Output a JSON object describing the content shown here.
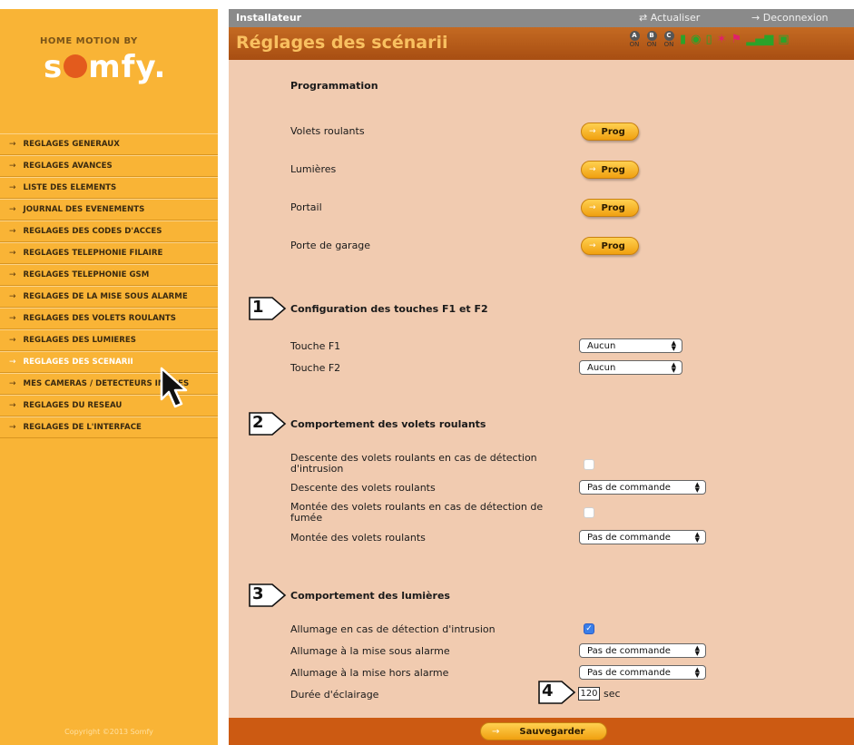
{
  "sidebar": {
    "brand_top": "HOME MOTION BY",
    "brand_logo_start": "s",
    "brand_logo_end": "mfy.",
    "menu": [
      {
        "label": "REGLAGES GENERAUX",
        "active": false
      },
      {
        "label": "REGLAGES AVANCES",
        "active": false
      },
      {
        "label": "LISTE DES ELEMENTS",
        "active": false
      },
      {
        "label": "JOURNAL DES EVENEMENTS",
        "active": false
      },
      {
        "label": "REGLAGES DES CODES D'ACCES",
        "active": false
      },
      {
        "label": "REGLAGES TELEPHONIE FILAIRE",
        "active": false
      },
      {
        "label": "REGLAGES TELEPHONIE GSM",
        "active": false
      },
      {
        "label": "REGLAGES DE LA MISE SOUS ALARME",
        "active": false
      },
      {
        "label": "REGLAGES DES VOLETS ROULANTS",
        "active": false
      },
      {
        "label": "REGLAGES DES LUMIERES",
        "active": false
      },
      {
        "label": "REGLAGES DES SCENARII",
        "active": true
      },
      {
        "label": "MES CAMERAS / DETECTEURS IMAGES",
        "active": false
      },
      {
        "label": "REGLAGES DU RESEAU",
        "active": false
      },
      {
        "label": "REGLAGES DE L'INTERFACE",
        "active": false
      }
    ],
    "copyright": "Copyright ©2013 Somfy"
  },
  "header": {
    "role": "Installateur",
    "refresh": "Actualiser",
    "logout": "Deconnexion",
    "page_title": "Réglages des scénarii",
    "zones": [
      {
        "letter": "A",
        "state": "ON"
      },
      {
        "letter": "B",
        "state": "ON"
      },
      {
        "letter": "C",
        "state": "ON"
      }
    ]
  },
  "programmation": {
    "title": "Programmation",
    "items": [
      {
        "label": "Volets roulants",
        "button": "Prog"
      },
      {
        "label": "Lumières",
        "button": "Prog"
      },
      {
        "label": "Portail",
        "button": "Prog"
      },
      {
        "label": "Porte de garage",
        "button": "Prog"
      }
    ]
  },
  "config_touches": {
    "marker": "1",
    "title": "Configuration des touches F1 et F2",
    "f1_label": "Touche F1",
    "f1_value": "Aucun",
    "f2_label": "Touche F2",
    "f2_value": "Aucun"
  },
  "volets": {
    "marker": "2",
    "title": "Comportement des volets roulants",
    "descente_intrusion_label": "Descente des volets roulants en cas de détection d'intrusion",
    "descente_intrusion_checked": false,
    "descente_label": "Descente des volets roulants",
    "descente_value": "Pas de commande",
    "montee_fumee_label": "Montée des volets roulants en cas de détection de fumée",
    "montee_fumee_checked": false,
    "montee_label": "Montée des volets roulants",
    "montee_value": "Pas de commande"
  },
  "lumieres": {
    "marker": "3",
    "title": "Comportement des lumières",
    "intrusion_label": "Allumage en cas de détection d'intrusion",
    "intrusion_checked": true,
    "mise_sous_label": "Allumage à la mise sous alarme",
    "mise_sous_value": "Pas de commande",
    "mise_hors_label": "Allumage à la mise hors alarme",
    "mise_hors_value": "Pas de commande",
    "duree_label": "Durée d'éclairage",
    "duree_marker": "4",
    "duree_value": "120",
    "duree_unit": "sec"
  },
  "footer": {
    "save": "Sauvegarder"
  },
  "colors": {
    "sidebar": "#f9b436",
    "header_bar": "#8a8a8a",
    "title_bar": "#b05a18",
    "content": "#f1cbb0",
    "footer": "#cc5a12"
  }
}
